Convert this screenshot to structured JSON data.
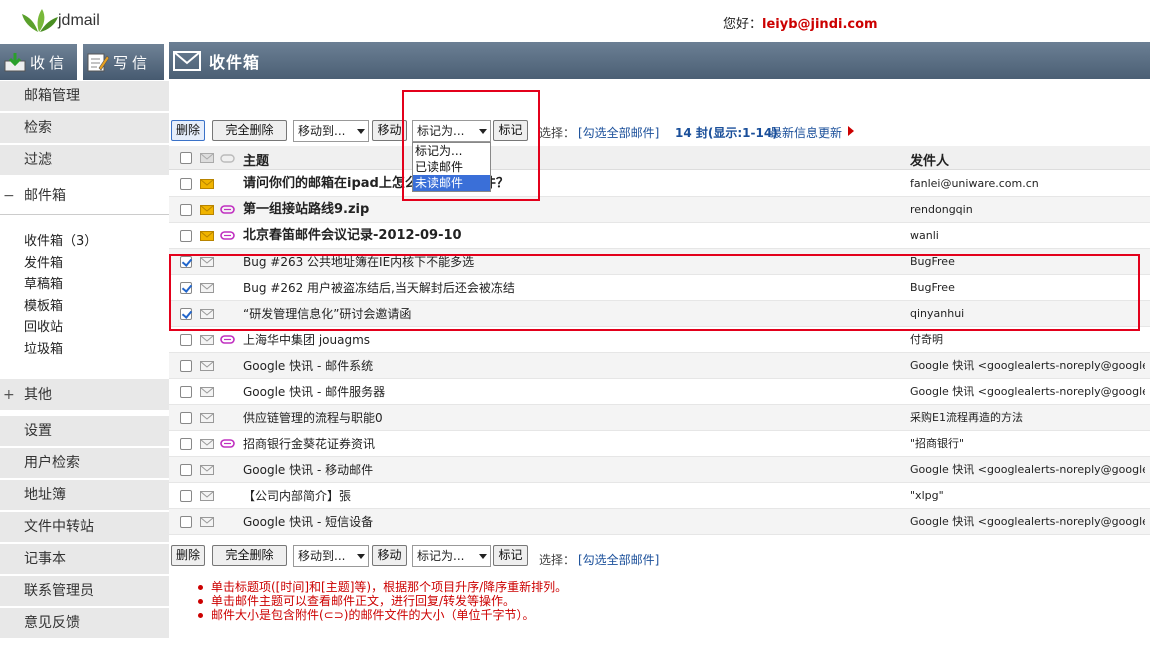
{
  "header": {
    "logo_text": "jdmail",
    "greeting_label": "您好：",
    "user_email": "leiyb@jindi.com"
  },
  "sidebar": {
    "inbox_button": "收信",
    "compose_button": "写信",
    "nav_top": [
      "邮箱管理",
      "检索",
      "过滤"
    ],
    "mailbox_section": {
      "sign": "−",
      "label": "邮件箱"
    },
    "folders": [
      "收件箱（3）",
      "发件箱",
      "草稿箱",
      "模板箱",
      "回收站",
      "垃圾箱"
    ],
    "other_section": {
      "sign": "+",
      "label": "其他"
    },
    "nav_bottom": [
      "设置",
      "用户检索",
      "地址簿",
      "文件中转站",
      "记事本",
      "联系管理员",
      "意见反馈"
    ]
  },
  "page": {
    "title": "收件箱"
  },
  "toolbar": {
    "delete": "删除",
    "delete_all": "完全删除",
    "move_select": "移动到...",
    "move_button": "移动",
    "mark_select": "标记为...",
    "mark_button": "标记",
    "select_label": "选择：",
    "select_all_link": "[勾选全部邮件]",
    "count_text": "14 封(显示:1-14)",
    "update_link": "最新信息更新"
  },
  "mark_dropdown": {
    "options": [
      "标记为...",
      "已读邮件",
      "未读邮件"
    ],
    "highlighted_index": 2
  },
  "list": {
    "col_subject": "主题",
    "col_sender": "发件人",
    "rows": [
      {
        "checked": false,
        "unread": true,
        "attachment": false,
        "bold": true,
        "subject": "请问你们的邮箱在ipad上怎么设置收取邮件？",
        "sender": "fanlei@uniware.com.cn"
      },
      {
        "checked": false,
        "unread": true,
        "attachment": true,
        "bold": true,
        "subject": "第一组接站路线9.zip",
        "sender": "rendongqin"
      },
      {
        "checked": false,
        "unread": true,
        "attachment": true,
        "bold": true,
        "subject": "北京春笛邮件会议记录-2012-09-10",
        "sender": "wanli"
      },
      {
        "checked": true,
        "unread": false,
        "attachment": false,
        "bold": false,
        "subject": "Bug #263 公共地址簿在IE内核下不能多选",
        "sender": "BugFree"
      },
      {
        "checked": true,
        "unread": false,
        "attachment": false,
        "bold": false,
        "subject": "Bug #262 用户被盗冻结后,当天解封后还会被冻结",
        "sender": "BugFree"
      },
      {
        "checked": true,
        "unread": false,
        "attachment": false,
        "bold": false,
        "subject": "“研发管理信息化”研讨会邀请函",
        "sender": "qinyanhui"
      },
      {
        "checked": false,
        "unread": false,
        "attachment": true,
        "bold": false,
        "subject": "上海华中集团  jouagms",
        "sender": "付奇明"
      },
      {
        "checked": false,
        "unread": false,
        "attachment": false,
        "bold": false,
        "subject": "Google 快讯 - 邮件系统",
        "sender": "Google 快讯  <googlealerts-noreply@google..."
      },
      {
        "checked": false,
        "unread": false,
        "attachment": false,
        "bold": false,
        "subject": "Google 快讯 - 邮件服务器",
        "sender": "Google 快讯  <googlealerts-noreply@google..."
      },
      {
        "checked": false,
        "unread": false,
        "attachment": false,
        "bold": false,
        "subject": "供应链管理的流程与职能0",
        "sender": "采购E1流程再造的方法"
      },
      {
        "checked": false,
        "unread": false,
        "attachment": true,
        "bold": false,
        "subject": "招商银行金葵花证券资讯",
        "sender": "\"招商银行\""
      },
      {
        "checked": false,
        "unread": false,
        "attachment": false,
        "bold": false,
        "subject": "Google 快讯 - 移动邮件",
        "sender": "Google 快讯  <googlealerts-noreply@google..."
      },
      {
        "checked": false,
        "unread": false,
        "attachment": false,
        "bold": false,
        "subject": "【公司内部简介】張",
        "sender": "\"xlpg\""
      },
      {
        "checked": false,
        "unread": false,
        "attachment": false,
        "bold": false,
        "subject": "Google 快讯 - 短信设备",
        "sender": "Google 快讯  <googlealerts-noreply@google..."
      }
    ]
  },
  "notes": [
    "单击标题项([时间]和[主题]等)，根据那个项目升序/降序重新排列。",
    "单击邮件主题可以查看邮件正文，进行回复/转发等操作。",
    "邮件大小是包含附件(⊂⊃)的邮件文件的大小（单位千字节）。"
  ],
  "colors": {
    "header_bar": "#546a80",
    "highlight_red": "#e3001b",
    "link_blue": "#1a4f9a",
    "note_red": "#cc0000",
    "unread_envelope": "#f0b400",
    "attachment_purple": "#c030c0"
  }
}
